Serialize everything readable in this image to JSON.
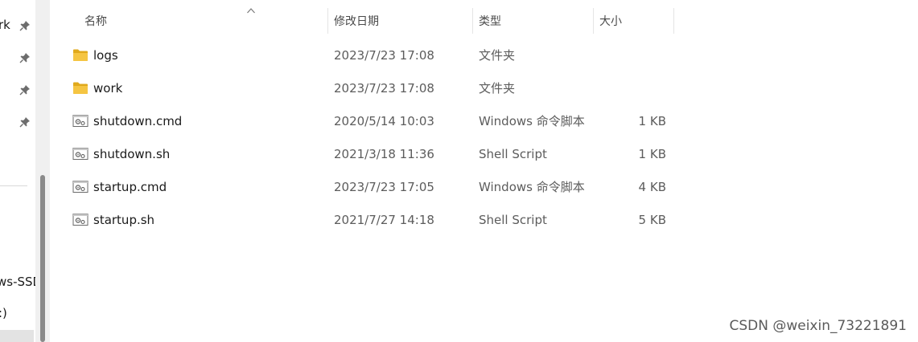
{
  "nav": {
    "items": [
      {
        "label": "rk",
        "pinned": true
      },
      {
        "label": "",
        "pinned": true
      },
      {
        "label": "",
        "pinned": true
      },
      {
        "label": "",
        "pinned": true
      }
    ],
    "drives": [
      {
        "label": "ws-SSD"
      },
      {
        "label": ":)"
      }
    ]
  },
  "columns": {
    "name": "名称",
    "date": "修改日期",
    "type": "类型",
    "size": "大小"
  },
  "files": [
    {
      "name": "logs",
      "date": "2023/7/23 17:08",
      "type": "文件夹",
      "size": "",
      "icon": "folder-icon"
    },
    {
      "name": "work",
      "date": "2023/7/23 17:08",
      "type": "文件夹",
      "size": "",
      "icon": "folder-icon"
    },
    {
      "name": "shutdown.cmd",
      "date": "2020/5/14 10:03",
      "type": "Windows 命令脚本",
      "size": "1 KB",
      "icon": "script-file-icon"
    },
    {
      "name": "shutdown.sh",
      "date": "2021/3/18 11:36",
      "type": "Shell Script",
      "size": "1 KB",
      "icon": "script-file-icon"
    },
    {
      "name": "startup.cmd",
      "date": "2023/7/23 17:05",
      "type": "Windows 命令脚本",
      "size": "4 KB",
      "icon": "script-file-icon"
    },
    {
      "name": "startup.sh",
      "date": "2021/7/27 14:18",
      "type": "Shell Script",
      "size": "5 KB",
      "icon": "script-file-icon"
    }
  ],
  "colors": {
    "folder": "#f5c542",
    "folder_dark": "#e0a91c"
  },
  "watermark": "CSDN @weixin_73221891"
}
